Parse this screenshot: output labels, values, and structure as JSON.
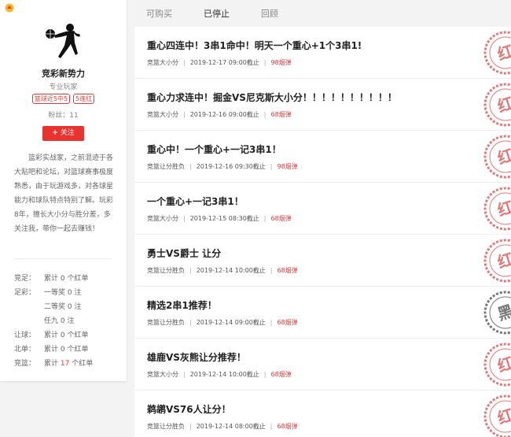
{
  "profile": {
    "name": "竞彩新势力",
    "title": "专业玩家",
    "tags": [
      "篮球近5中5",
      "5连红"
    ],
    "fans": "粉丝：11",
    "follow_label": "关注",
    "bio": "篮彩实战家，之前混迹于各大贴吧和论坛，对篮球赛事极度熟悉，由于玩游戏多，对各球星能力和球队特点特别了解。玩彩8年，擅长大小分与胜分差，多关注我，带你一起去赚钱！",
    "stats": [
      {
        "key": "竞足：",
        "pre": "累计 ",
        "num": "0",
        "post": " 个红单"
      },
      {
        "key": "足彩：",
        "pre": "一等奖 ",
        "num": "0",
        "post": " 注"
      },
      {
        "key": "",
        "pre": "二等奖 ",
        "num": "0",
        "post": " 注"
      },
      {
        "key": "",
        "pre": "任九 ",
        "num": "0",
        "post": " 注"
      },
      {
        "key": "让球：",
        "pre": "累计 ",
        "num": "0",
        "post": " 个红单"
      },
      {
        "key": "北单：",
        "pre": "累计 ",
        "num": "0",
        "post": " 个红单"
      },
      {
        "key": "竞篮：",
        "pre": "累计 ",
        "num": "17",
        "post": " 个红单"
      }
    ],
    "colors": {
      "accent": "#e8332e"
    }
  },
  "tabs": [
    {
      "label": "可购买",
      "active": false
    },
    {
      "label": "已停止",
      "active": true
    },
    {
      "label": "回顾",
      "active": false
    }
  ],
  "items": [
    {
      "title": "重心四连中！3串1命中！明天一个重心+1个3串1!",
      "category": "竞篮大小分",
      "time": "2019-12-17 09:00截止",
      "price": "98烟弹",
      "result": "红"
    },
    {
      "title": "重心力求连中！掘金VS尼克斯大小分！！！！！！！！！！",
      "category": "竞篮大小分",
      "time": "2019-12-16 09:00截止",
      "price": "68烟弹",
      "result": "红"
    },
    {
      "title": "重心中！一个重心+一记3串1！",
      "category": "竞篮让分胜负",
      "time": "2019-12-16 09:30截止",
      "price": "98烟弹",
      "result": "红"
    },
    {
      "title": "一个重心+一记3串1！",
      "category": "竞篮大小分",
      "time": "2019-12-15 08:30截止",
      "price": "68烟弹",
      "result": "红"
    },
    {
      "title": "勇士VS爵士 让分",
      "category": "竞篮让分胜负",
      "time": "2019-12-14 10:00截止",
      "price": "68烟弹",
      "result": "红"
    },
    {
      "title": "精选2串1推荐！",
      "category": "竞篮让分胜负",
      "time": "2019-12-14 09:00截止",
      "price": "68烟弹",
      "result": "黑"
    },
    {
      "title": "雄鹿VS灰熊让分推荐！",
      "category": "竞篮大小分",
      "time": "2019-12-14 10:00截止",
      "price": "68烟弹",
      "result": "红"
    },
    {
      "title": "鹈鹕VS76人让分！",
      "category": "竞篮让分胜负",
      "time": "2019-12-14 08:00截止",
      "price": "68烟弹",
      "result": "红"
    }
  ]
}
